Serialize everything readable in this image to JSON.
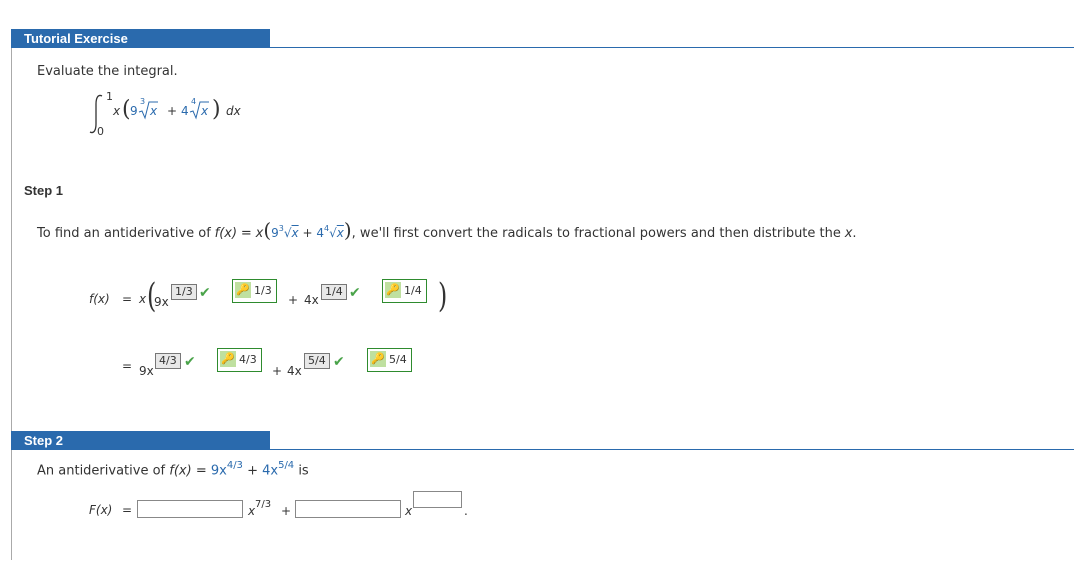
{
  "header": {
    "title": "Tutorial Exercise"
  },
  "problem": {
    "instruction": "Evaluate the integral.",
    "integral_upper": "1",
    "integral_lower": "0",
    "x": "x",
    "nine": "9",
    "cube_index": "3",
    "plus": "+",
    "four": "4",
    "fourth_index": "4",
    "dx": "dx"
  },
  "step1": {
    "label": "Step 1",
    "intro_before": "To find an antiderivative of",
    "fx": "f(x)",
    "eq": "=",
    "intro_after": ", we'll first convert the radicals to fractional powers and then distribute the",
    "intro_x": "x",
    "intro_end": ".",
    "row1": {
      "lhs": "f(x)",
      "eq": "=",
      "x": "x",
      "term1_base": "9x",
      "term1_exp": "1/3",
      "term1_key": "1/3",
      "plus": "+",
      "term2_base": "4x",
      "term2_exp": "1/4",
      "term2_key": "1/4"
    },
    "row2": {
      "eq": "=",
      "term1_base": "9x",
      "term1_exp": "4/3",
      "term1_key": "4/3",
      "plus": "+",
      "term2_base": "4x",
      "term2_exp": "5/4",
      "term2_key": "5/4"
    }
  },
  "step2": {
    "label": "Step 2",
    "sentence_start": "An antiderivative of",
    "fx": "f(x)",
    "eq": "=",
    "t1": "9x",
    "t1_exp": "4/3",
    "plus": "+",
    "t2": "4x",
    "t2_exp": "5/4",
    "is": "is",
    "lhs": "F(x)",
    "lhs_eq": "=",
    "x1": "x",
    "x1_exp": "7/3",
    "plus2": "+",
    "x2": "x",
    "period": ".",
    "input1_value": "",
    "input2_value": "",
    "input3_value": ""
  },
  "colors": {
    "accent": "#2a6aad",
    "check": "#4aa34a",
    "key_border": "#2e8b2e"
  }
}
